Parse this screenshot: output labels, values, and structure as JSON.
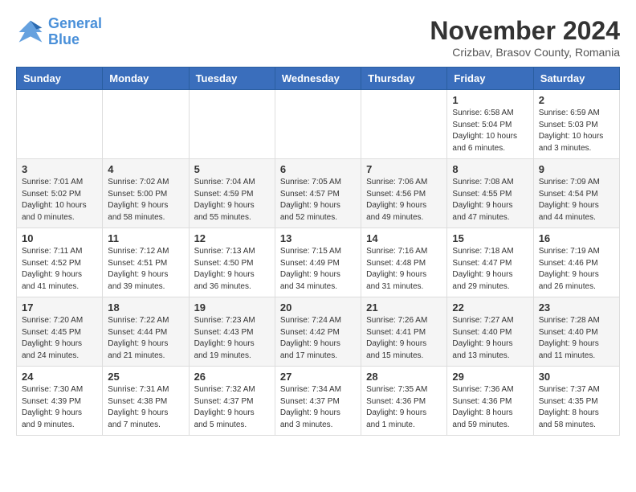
{
  "logo": {
    "line1": "General",
    "line2": "Blue"
  },
  "title": {
    "month_year": "November 2024",
    "location": "Crizbav, Brasov County, Romania"
  },
  "header_days": [
    "Sunday",
    "Monday",
    "Tuesday",
    "Wednesday",
    "Thursday",
    "Friday",
    "Saturday"
  ],
  "weeks": [
    [
      {
        "day": "",
        "info": ""
      },
      {
        "day": "",
        "info": ""
      },
      {
        "day": "",
        "info": ""
      },
      {
        "day": "",
        "info": ""
      },
      {
        "day": "",
        "info": ""
      },
      {
        "day": "1",
        "info": "Sunrise: 6:58 AM\nSunset: 5:04 PM\nDaylight: 10 hours\nand 6 minutes."
      },
      {
        "day": "2",
        "info": "Sunrise: 6:59 AM\nSunset: 5:03 PM\nDaylight: 10 hours\nand 3 minutes."
      }
    ],
    [
      {
        "day": "3",
        "info": "Sunrise: 7:01 AM\nSunset: 5:02 PM\nDaylight: 10 hours\nand 0 minutes."
      },
      {
        "day": "4",
        "info": "Sunrise: 7:02 AM\nSunset: 5:00 PM\nDaylight: 9 hours\nand 58 minutes."
      },
      {
        "day": "5",
        "info": "Sunrise: 7:04 AM\nSunset: 4:59 PM\nDaylight: 9 hours\nand 55 minutes."
      },
      {
        "day": "6",
        "info": "Sunrise: 7:05 AM\nSunset: 4:57 PM\nDaylight: 9 hours\nand 52 minutes."
      },
      {
        "day": "7",
        "info": "Sunrise: 7:06 AM\nSunset: 4:56 PM\nDaylight: 9 hours\nand 49 minutes."
      },
      {
        "day": "8",
        "info": "Sunrise: 7:08 AM\nSunset: 4:55 PM\nDaylight: 9 hours\nand 47 minutes."
      },
      {
        "day": "9",
        "info": "Sunrise: 7:09 AM\nSunset: 4:54 PM\nDaylight: 9 hours\nand 44 minutes."
      }
    ],
    [
      {
        "day": "10",
        "info": "Sunrise: 7:11 AM\nSunset: 4:52 PM\nDaylight: 9 hours\nand 41 minutes."
      },
      {
        "day": "11",
        "info": "Sunrise: 7:12 AM\nSunset: 4:51 PM\nDaylight: 9 hours\nand 39 minutes."
      },
      {
        "day": "12",
        "info": "Sunrise: 7:13 AM\nSunset: 4:50 PM\nDaylight: 9 hours\nand 36 minutes."
      },
      {
        "day": "13",
        "info": "Sunrise: 7:15 AM\nSunset: 4:49 PM\nDaylight: 9 hours\nand 34 minutes."
      },
      {
        "day": "14",
        "info": "Sunrise: 7:16 AM\nSunset: 4:48 PM\nDaylight: 9 hours\nand 31 minutes."
      },
      {
        "day": "15",
        "info": "Sunrise: 7:18 AM\nSunset: 4:47 PM\nDaylight: 9 hours\nand 29 minutes."
      },
      {
        "day": "16",
        "info": "Sunrise: 7:19 AM\nSunset: 4:46 PM\nDaylight: 9 hours\nand 26 minutes."
      }
    ],
    [
      {
        "day": "17",
        "info": "Sunrise: 7:20 AM\nSunset: 4:45 PM\nDaylight: 9 hours\nand 24 minutes."
      },
      {
        "day": "18",
        "info": "Sunrise: 7:22 AM\nSunset: 4:44 PM\nDaylight: 9 hours\nand 21 minutes."
      },
      {
        "day": "19",
        "info": "Sunrise: 7:23 AM\nSunset: 4:43 PM\nDaylight: 9 hours\nand 19 minutes."
      },
      {
        "day": "20",
        "info": "Sunrise: 7:24 AM\nSunset: 4:42 PM\nDaylight: 9 hours\nand 17 minutes."
      },
      {
        "day": "21",
        "info": "Sunrise: 7:26 AM\nSunset: 4:41 PM\nDaylight: 9 hours\nand 15 minutes."
      },
      {
        "day": "22",
        "info": "Sunrise: 7:27 AM\nSunset: 4:40 PM\nDaylight: 9 hours\nand 13 minutes."
      },
      {
        "day": "23",
        "info": "Sunrise: 7:28 AM\nSunset: 4:40 PM\nDaylight: 9 hours\nand 11 minutes."
      }
    ],
    [
      {
        "day": "24",
        "info": "Sunrise: 7:30 AM\nSunset: 4:39 PM\nDaylight: 9 hours\nand 9 minutes."
      },
      {
        "day": "25",
        "info": "Sunrise: 7:31 AM\nSunset: 4:38 PM\nDaylight: 9 hours\nand 7 minutes."
      },
      {
        "day": "26",
        "info": "Sunrise: 7:32 AM\nSunset: 4:37 PM\nDaylight: 9 hours\nand 5 minutes."
      },
      {
        "day": "27",
        "info": "Sunrise: 7:34 AM\nSunset: 4:37 PM\nDaylight: 9 hours\nand 3 minutes."
      },
      {
        "day": "28",
        "info": "Sunrise: 7:35 AM\nSunset: 4:36 PM\nDaylight: 9 hours\nand 1 minute."
      },
      {
        "day": "29",
        "info": "Sunrise: 7:36 AM\nSunset: 4:36 PM\nDaylight: 8 hours\nand 59 minutes."
      },
      {
        "day": "30",
        "info": "Sunrise: 7:37 AM\nSunset: 4:35 PM\nDaylight: 8 hours\nand 58 minutes."
      }
    ]
  ]
}
